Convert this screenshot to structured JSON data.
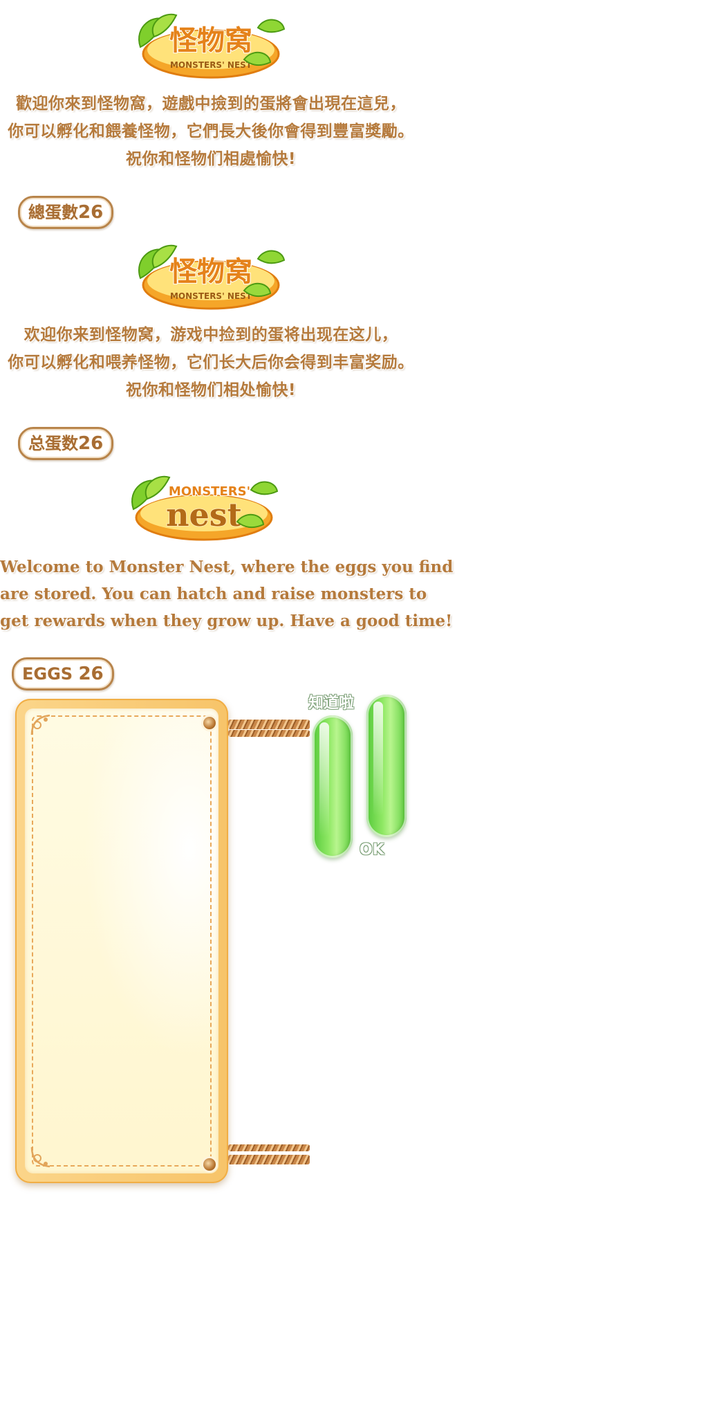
{
  "sections": [
    {
      "logo": {
        "title": "怪物窝",
        "subtitle": "MONSTERS' NEST"
      },
      "intro_lines": [
        "歡迎你來到怪物窩，遊戲中撿到的蛋將會出現在這兒，",
        "你可以孵化和餵養怪物，它們長大後你會得到豐富獎勵。",
        "祝你和怪物们相處愉快!"
      ],
      "egg_label": "總蛋數",
      "egg_count": "26"
    },
    {
      "logo": {
        "title": "怪物窝",
        "subtitle": "MONSTERS' NEST"
      },
      "intro_lines": [
        "欢迎你来到怪物窝，游戏中捡到的蛋将出现在这儿，",
        "你可以孵化和喂养怪物，它们长大后你会得到丰富奖励。",
        "祝你和怪物们相处愉快!"
      ],
      "egg_label": "总蛋数",
      "egg_count": "26"
    },
    {
      "logo": {
        "title": "nest",
        "subtitle": "MONSTERS'"
      },
      "intro_lines": [
        "Welcome to Monster Nest, where the eggs you find",
        "are stored. You can hatch and raise monsters to",
        "get rewards when they grow up. Have a good time!"
      ],
      "egg_label": "EGGS",
      "egg_count": "26"
    }
  ],
  "buttons": {
    "cn_label": "知道啦",
    "en_label": "OK"
  },
  "colors": {
    "text_brown": "#b57a3c",
    "badge_border": "#b8844a",
    "panel_orange": "#f7c469",
    "panel_cream": "#fff8d6",
    "button_green": "#6fd64c"
  },
  "icons": [
    "leaf-icon",
    "corner-flourish-icon",
    "rivet-icon",
    "rope-icon"
  ]
}
